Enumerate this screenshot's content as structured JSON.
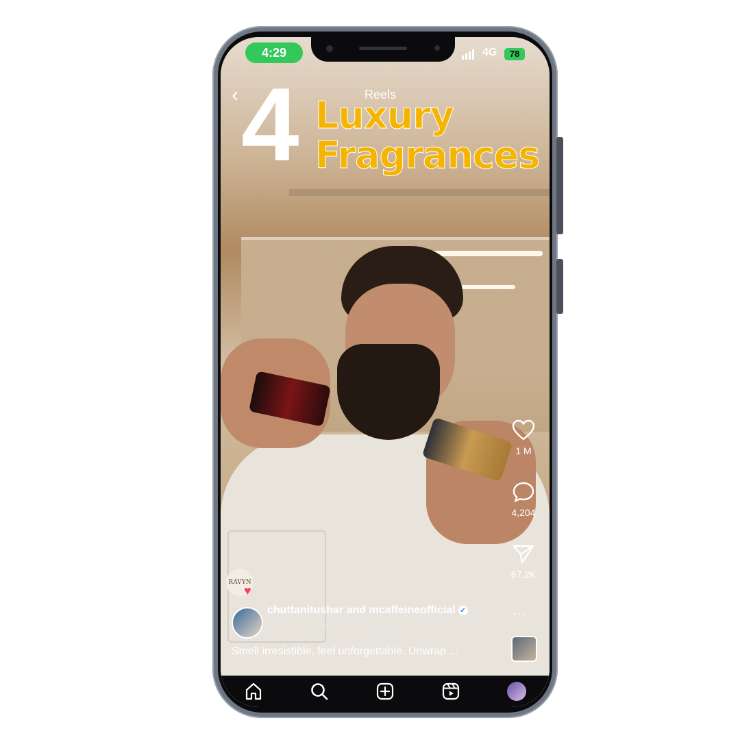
{
  "status_bar": {
    "time": "4:29",
    "network": "4G",
    "battery": "78"
  },
  "header": {
    "title": "Reels"
  },
  "overlay_text": {
    "number": "4",
    "line1": "Luxury",
    "line2": "Fragrances"
  },
  "actions": {
    "like": {
      "icon": "heart-icon",
      "count": "1 M"
    },
    "comment": {
      "icon": "comment-icon",
      "count": "4,204"
    },
    "share": {
      "icon": "send-icon",
      "count": "67.2K"
    },
    "more": {
      "label": "..."
    }
  },
  "post": {
    "audio_badge_text": "RAVYN",
    "username": "chuttanitushar and mcaffeineofficial",
    "partnership": "Paid partnership with mcaffeineofficial",
    "caption": "Smell irresistible, feel unforgettable. Unwrap ..."
  },
  "bottom_nav": [
    {
      "icon": "home-icon"
    },
    {
      "icon": "search-icon"
    },
    {
      "icon": "create-icon"
    },
    {
      "icon": "reels-icon"
    },
    {
      "icon": "profile-avatar"
    }
  ],
  "colors": {
    "headline": "#f5b400",
    "status_green": "#34c759"
  }
}
